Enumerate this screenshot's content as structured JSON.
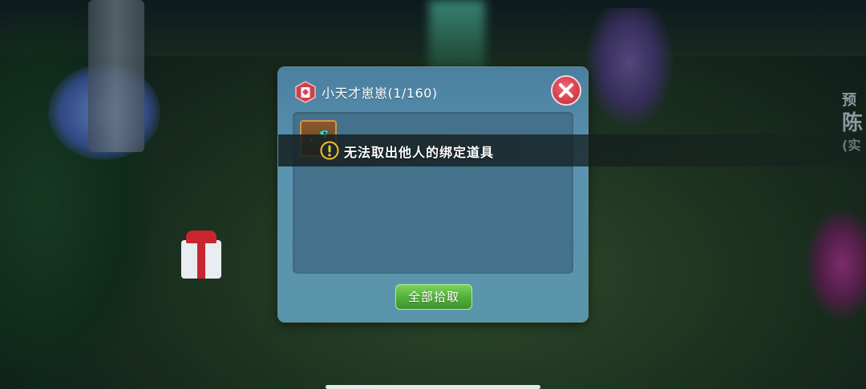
{
  "scene": {
    "npc_name_fragment": [
      "预",
      "陈",
      "(实"
    ]
  },
  "dialog": {
    "title": "小天才崽崽(1/160)",
    "header_icon": "storage-bag-icon",
    "close_icon": "close-icon",
    "loot_items": [
      {
        "icon": "fish-key-item-icon"
      }
    ],
    "pickup_all_label": "全部拾取"
  },
  "toast": {
    "icon": "warning-icon",
    "message": "无法取出他人的绑定道具"
  },
  "colors": {
    "dialog_bg": "#5b94b0",
    "loot_area_bg": "#44718b",
    "close_red": "#d43f4d",
    "pickup_green": "#4fae39",
    "warning_yellow": "#f2c230"
  }
}
